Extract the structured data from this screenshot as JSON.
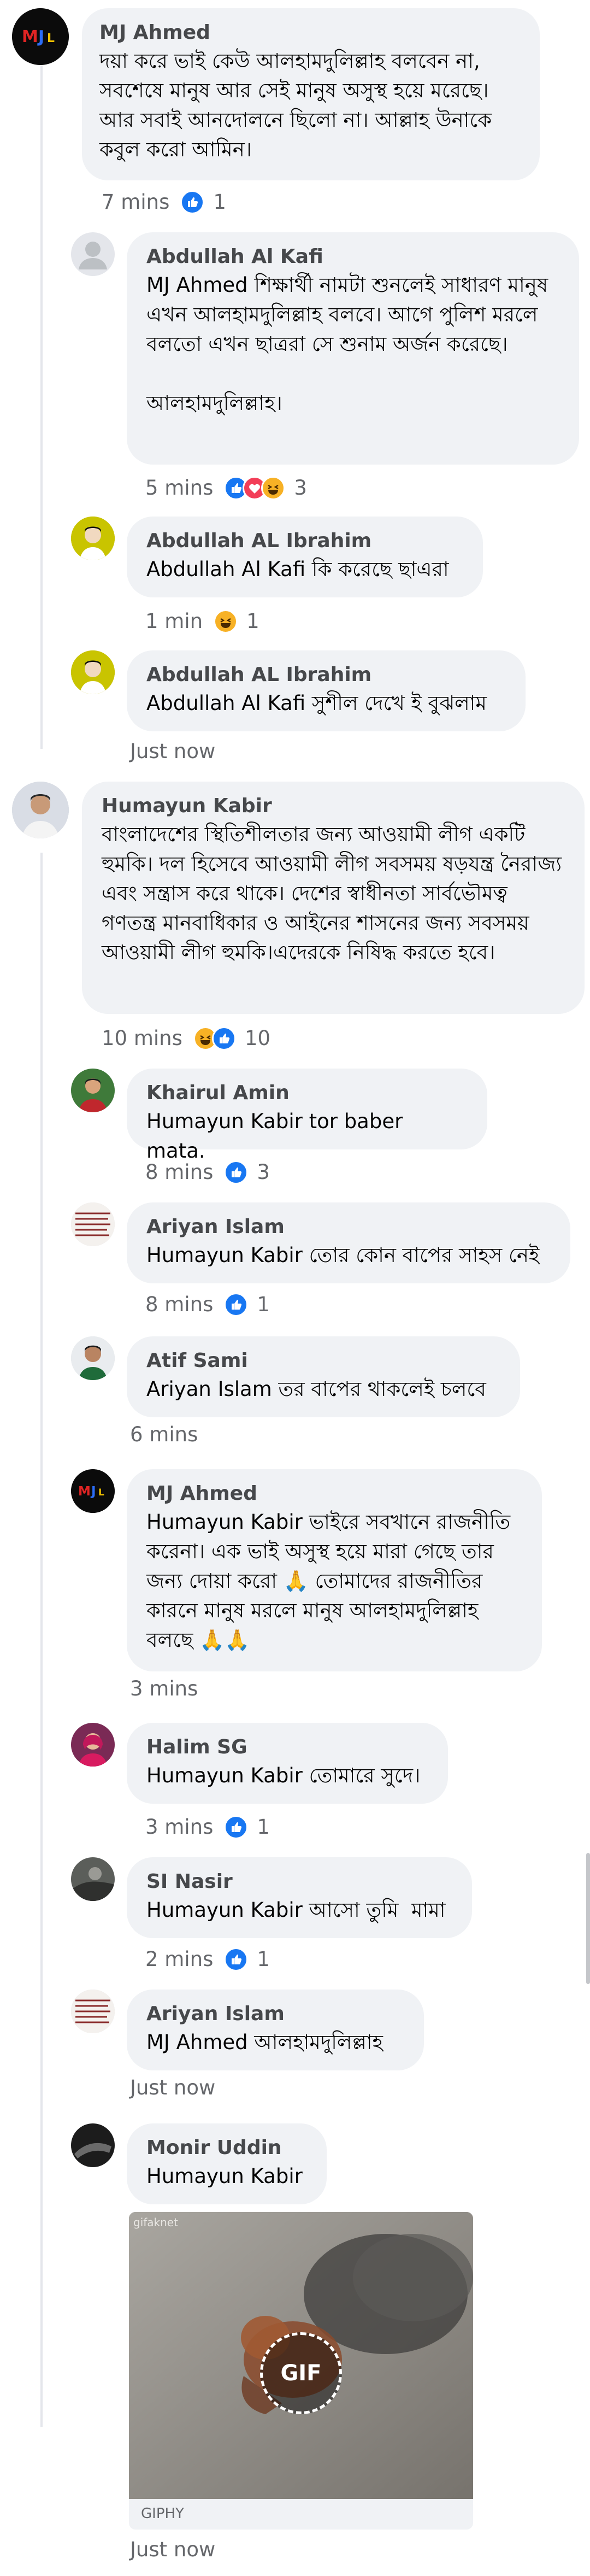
{
  "comments": [
    {
      "name": "MJ Ahmed",
      "text": "দয়া করে ভাই কেউ আলহামদুলিল্লাহ বলবেন না, সবশেষে মানুষ আর সেই মানুষ অসুস্থ হয়ে মরেছে। আর সবাই আনদোলনে ছিলো না। আল্লাহ উনাকে কবুল করো আমিন।",
      "time": "7 mins",
      "reactions": [
        "like"
      ],
      "reaction_count": "1"
    },
    {
      "name": "Abdullah Al Kafi",
      "text": "MJ Ahmed শিক্ষার্থী নামটা শুনলেই সাধারণ মানুষ এখন আলহামদুলিল্লাহ বলবে। আগে পুলিশ মরলে বলতো এখন ছাত্ররা সে শুনাম অর্জন করেছে।\n\nআলহামদুলিল্লাহ।",
      "time": "5 mins",
      "reactions": [
        "like",
        "love",
        "haha"
      ],
      "reaction_count": "3"
    },
    {
      "name": "Abdullah AL Ibrahim",
      "text": "Abdullah Al Kafi কি করেছে ছাএরা",
      "time": "1 min",
      "reactions": [
        "haha"
      ],
      "reaction_count": "1"
    },
    {
      "name": "Abdullah AL Ibrahim",
      "text": "Abdullah Al Kafi সুশীল দেখে ই বুঝলাম",
      "time": "Just now",
      "reactions": [],
      "reaction_count": ""
    },
    {
      "name": "Humayun Kabir",
      "text": "বাংলাদেশের স্থিতিশীলতার জন্য আওয়ামী লীগ একটি হুমকি। দল হিসেবে আওয়ামী লীগ সবসময় ষড়যন্ত্র নৈরাজ্য এবং সন্ত্রাস করে থাকে। দেশের স্বাধীনতা সার্বভৌমত্ব গণতন্ত্র মানবাধিকার ও আইনের শাসনের জন্য সবসময় আওয়ামী লীগ হুমকি।এদেরকে নিষিদ্ধ করতে হবে।",
      "time": "10 mins",
      "reactions": [
        "haha",
        "like"
      ],
      "reaction_count": "10"
    },
    {
      "name": "Khairul Amin",
      "text": "Humayun Kabir tor baber mata.",
      "time": "8 mins",
      "reactions": [
        "like"
      ],
      "reaction_count": "3"
    },
    {
      "name": "Ariyan Islam",
      "text": "Humayun Kabir তোর কোন বাপের সাহস নেই",
      "time": "8 mins",
      "reactions": [
        "like"
      ],
      "reaction_count": "1"
    },
    {
      "name": "Atif Sami",
      "text": "Ariyan Islam তর বাপের থাকলেই চলবে",
      "time": "6 mins",
      "reactions": [],
      "reaction_count": ""
    },
    {
      "name": "MJ Ahmed",
      "text": "Humayun Kabir ভাইরে সবখানে রাজনীতি করেনা। এক ভাই অসুস্থ হয়ে মারা গেছে তার জন্য দোয়া করো 🙏 তোমাদের রাজনীতির কারনে মানুষ মরলে মানুষ আলহামদুলিল্লাহ বলছে 🙏🙏",
      "time": "3 mins",
      "reactions": [],
      "reaction_count": ""
    },
    {
      "name": "Halim SG",
      "text": "Humayun Kabir তোমারে সুদে।",
      "time": "3 mins",
      "reactions": [
        "like"
      ],
      "reaction_count": "1"
    },
    {
      "name": "SI Nasir",
      "text": "Humayun Kabir আসো তুমি  মামা",
      "time": "2 mins",
      "reactions": [
        "like"
      ],
      "reaction_count": "1"
    },
    {
      "name": "Ariyan Islam",
      "text": "MJ Ahmed আলহামদুলিল্লাহ",
      "time": "Just now",
      "reactions": [],
      "reaction_count": ""
    },
    {
      "name": "Monir Uddin",
      "text": "Humayun Kabir",
      "time": "Just now",
      "reactions": [],
      "reaction_count": ""
    }
  ],
  "gif": {
    "badge": "GIF",
    "watermark": "gifaknet",
    "source": "GIPHY"
  },
  "avatars": {
    "mj_ahmed": "MJ logo",
    "colors": {
      "like": "#1877f2",
      "love": "#f33e58",
      "haha": "#f7b125",
      "bubble": "#f0f2f5",
      "meta": "#65676b"
    }
  }
}
